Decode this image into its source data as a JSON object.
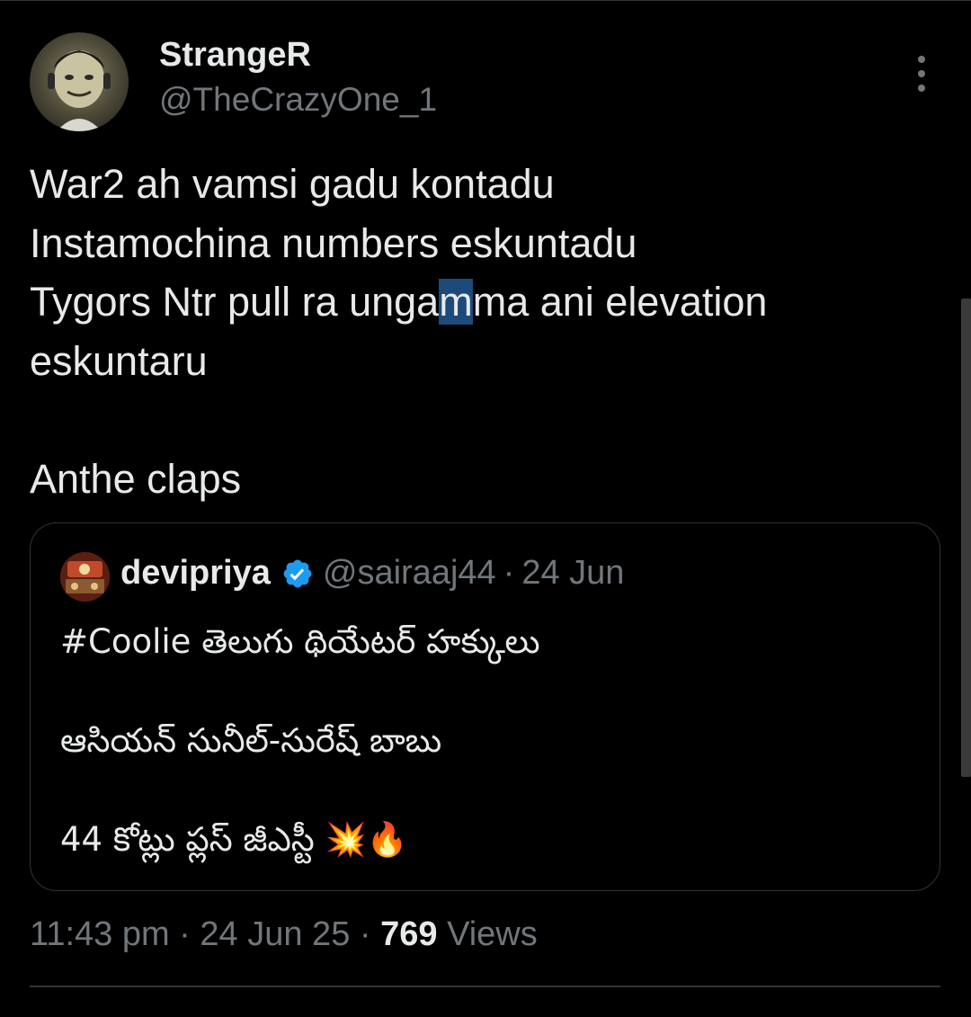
{
  "author": {
    "display_name": "StrangeR",
    "handle": "@TheCrazyOne_1"
  },
  "more_menu_icon": "more-vertical-icon",
  "tweet": {
    "lines": [
      "War2 ah vamsi gadu kontadu",
      "Instamochina numbers eskuntadu",
      {
        "before": "Tygors Ntr pull ra unga",
        "selected": "m",
        "after": "ma ani elevation"
      },
      "eskuntaru",
      "",
      "Anthe claps"
    ]
  },
  "quoted": {
    "display_name": "devipriya",
    "verified_icon": "verified-badge-icon",
    "handle": "@sairaaj44",
    "separator": "·",
    "date": "24 Jun",
    "lines": {
      "l1": "#Coolie తెలుగు థియేటర్ హక్కులు",
      "l2": "ఆసియన్ సునీల్-సురేష్ బాబు",
      "l3": "44 కోట్లు ప్లస్ జీఎస్టీ 💥🔥"
    }
  },
  "meta": {
    "time": "11:43 pm",
    "sep1": " · ",
    "date": "24 Jun 25",
    "sep2": " · ",
    "views_count": "769",
    "views_label": " Views"
  },
  "colors": {
    "background": "#000000",
    "text": "#e7e9ea",
    "secondary": "#71767b",
    "border": "#2f3336",
    "verified": "#1d9bf0",
    "selection": "#1d4a7a"
  }
}
